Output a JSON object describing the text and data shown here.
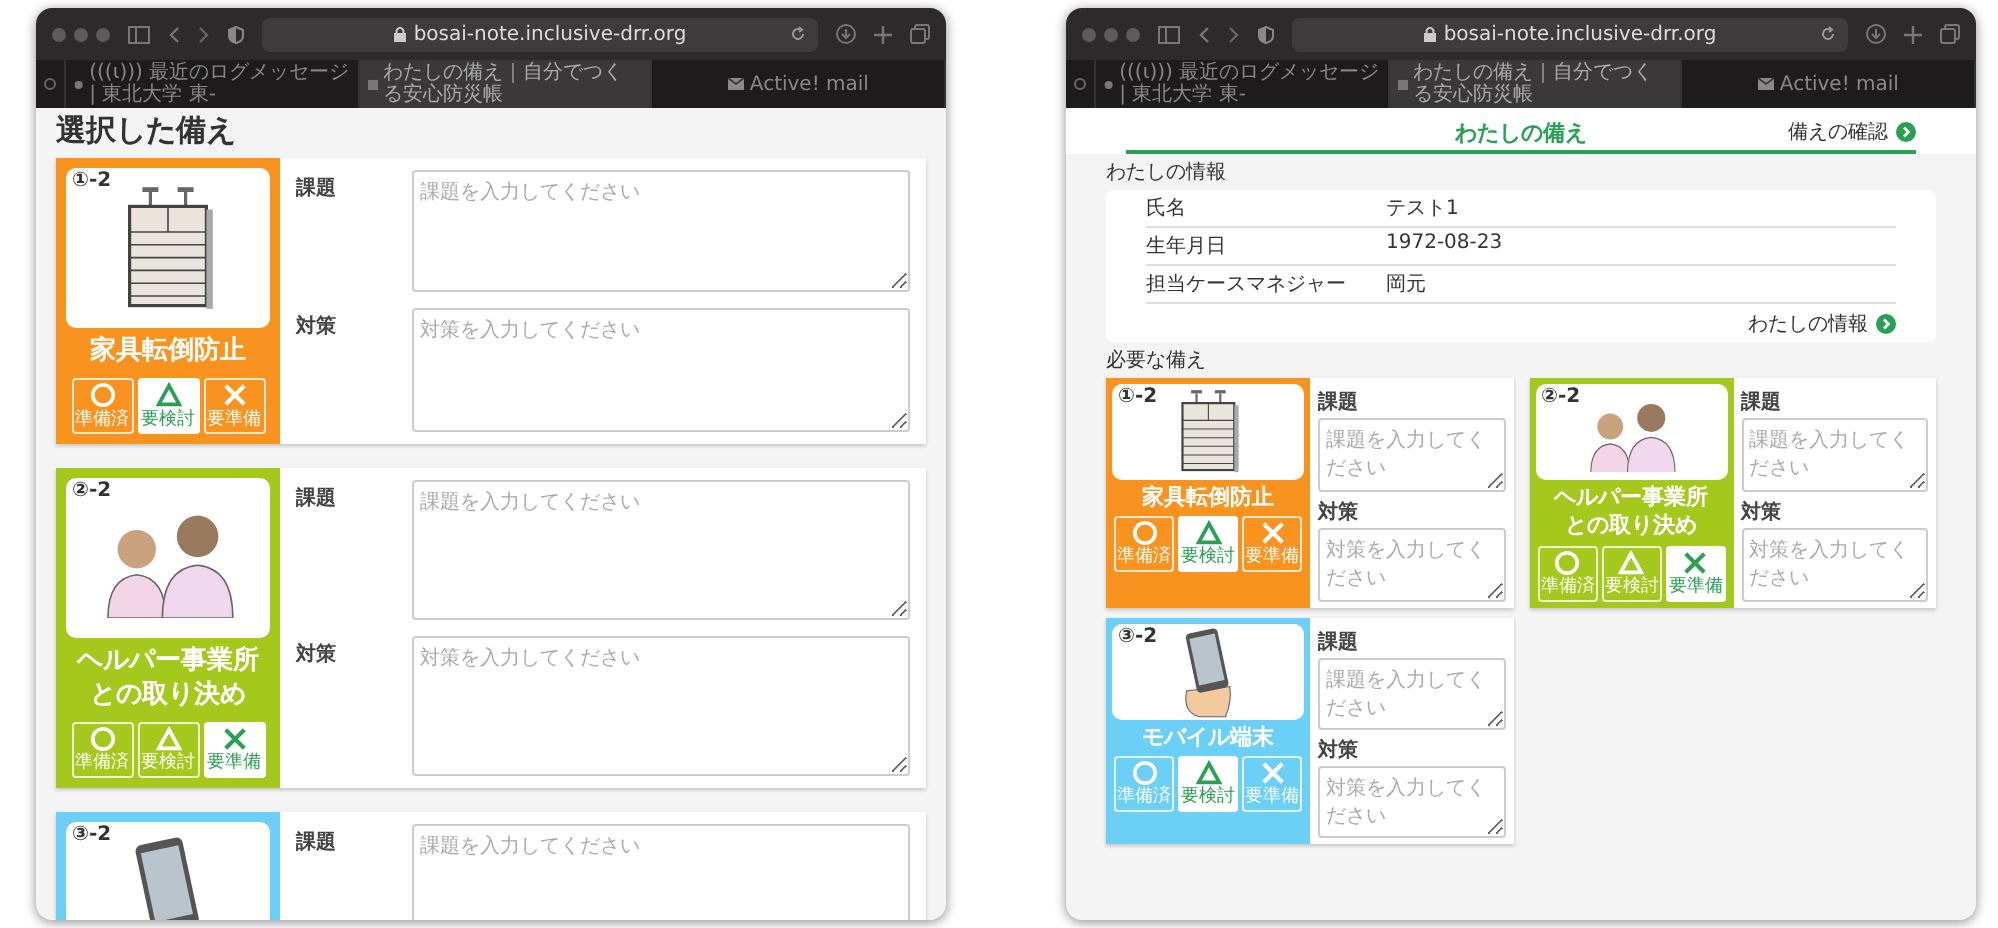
{
  "windows": [
    {
      "url": "bosai-note.inclusive-drr.org",
      "tabs": [
        {
          "label": "(((ι))) 最近のログメッセージ | 東北大学 東-",
          "selected": false,
          "kind": "site"
        },
        {
          "label": "わたしの備え｜自分でつくる安心防災帳",
          "selected": true,
          "kind": "page"
        },
        {
          "label": "Active! mail",
          "selected": false,
          "kind": "mail"
        }
      ],
      "page": {
        "kind": "selected",
        "heading": "選択した備え",
        "items": [
          {
            "badge": "①-2",
            "color": "#f7931e",
            "kind": "cabinet",
            "name": "家具転倒防止",
            "issue_label": "課題",
            "issue_placeholder": "課題を入力してください",
            "measure_label": "対策",
            "measure_placeholder": "対策を入力してください",
            "statuses": [
              {
                "kind": "circle",
                "label": "準備済",
                "selected": false
              },
              {
                "kind": "triangle",
                "label": "要検討",
                "selected": true
              },
              {
                "kind": "cross",
                "label": "要準備",
                "selected": false
              }
            ]
          },
          {
            "badge": "②-2",
            "color": "#a5c81c",
            "kind": "people",
            "name": "ヘルパー事業所との取り決め",
            "issue_label": "課題",
            "issue_placeholder": "課題を入力してください",
            "measure_label": "対策",
            "measure_placeholder": "対策を入力してください",
            "statuses": [
              {
                "kind": "circle",
                "label": "準備済",
                "selected": false
              },
              {
                "kind": "triangle",
                "label": "要検討",
                "selected": false
              },
              {
                "kind": "cross",
                "label": "要準備",
                "selected": true
              }
            ]
          },
          {
            "badge": "③-2",
            "color": "#6ccff6",
            "kind": "phone",
            "issue_label": "課題",
            "issue_placeholder": "課題を入力してください"
          }
        ]
      }
    },
    {
      "url": "bosai-note.inclusive-drr.org",
      "tabs": [
        {
          "label": "(((ι))) 最近のログメッセージ | 東北大学 東-",
          "selected": false,
          "kind": "site"
        },
        {
          "label": "わたしの備え｜自分でつくる安心防災帳",
          "selected": true,
          "kind": "page"
        },
        {
          "label": "Active! mail",
          "selected": false,
          "kind": "mail"
        }
      ],
      "page": {
        "kind": "overview",
        "title": "わたしの備え",
        "confirm_link": "備えの確認",
        "info_heading": "わたしの情報",
        "info_rows": [
          {
            "label": "氏名",
            "value": "テスト1"
          },
          {
            "label": "生年月日",
            "value": "1972-08-23"
          },
          {
            "label": "担当ケースマネジャー",
            "value": "岡元"
          }
        ],
        "info_link": "わたしの情報",
        "needed_heading": "必要な備え",
        "items": [
          {
            "badge": "①-2",
            "color": "#f7931e",
            "kind": "cabinet",
            "name": "家具転倒防止",
            "issue_label": "課題",
            "issue_placeholder": "課題を入力してください",
            "measure_label": "対策",
            "measure_placeholder": "対策を入力してください",
            "statuses": [
              {
                "kind": "circle",
                "label": "準備済",
                "selected": false
              },
              {
                "kind": "triangle",
                "label": "要検討",
                "selected": true
              },
              {
                "kind": "cross",
                "label": "要準備",
                "selected": false
              }
            ]
          },
          {
            "badge": "②-2",
            "color": "#a5c81c",
            "kind": "people",
            "name": "ヘルパー事業所との取り決め",
            "issue_label": "課題",
            "issue_placeholder": "課題を入力してください",
            "measure_label": "対策",
            "measure_placeholder": "対策を入力してください",
            "statuses": [
              {
                "kind": "circle",
                "label": "準備済",
                "selected": false
              },
              {
                "kind": "triangle",
                "label": "要検討",
                "selected": false
              },
              {
                "kind": "cross",
                "label": "要準備",
                "selected": true
              }
            ]
          },
          {
            "badge": "③-2",
            "color": "#6ccff6",
            "kind": "phone",
            "name": "モバイル端末",
            "issue_label": "課題",
            "issue_placeholder": "課題を入力してください",
            "measure_label": "対策",
            "measure_placeholder": "対策を入力してください",
            "statuses": [
              {
                "kind": "circle",
                "label": "準備済",
                "selected": false
              },
              {
                "kind": "triangle",
                "label": "要検討",
                "selected": true
              },
              {
                "kind": "cross",
                "label": "要準備",
                "selected": false
              }
            ]
          }
        ]
      }
    }
  ]
}
